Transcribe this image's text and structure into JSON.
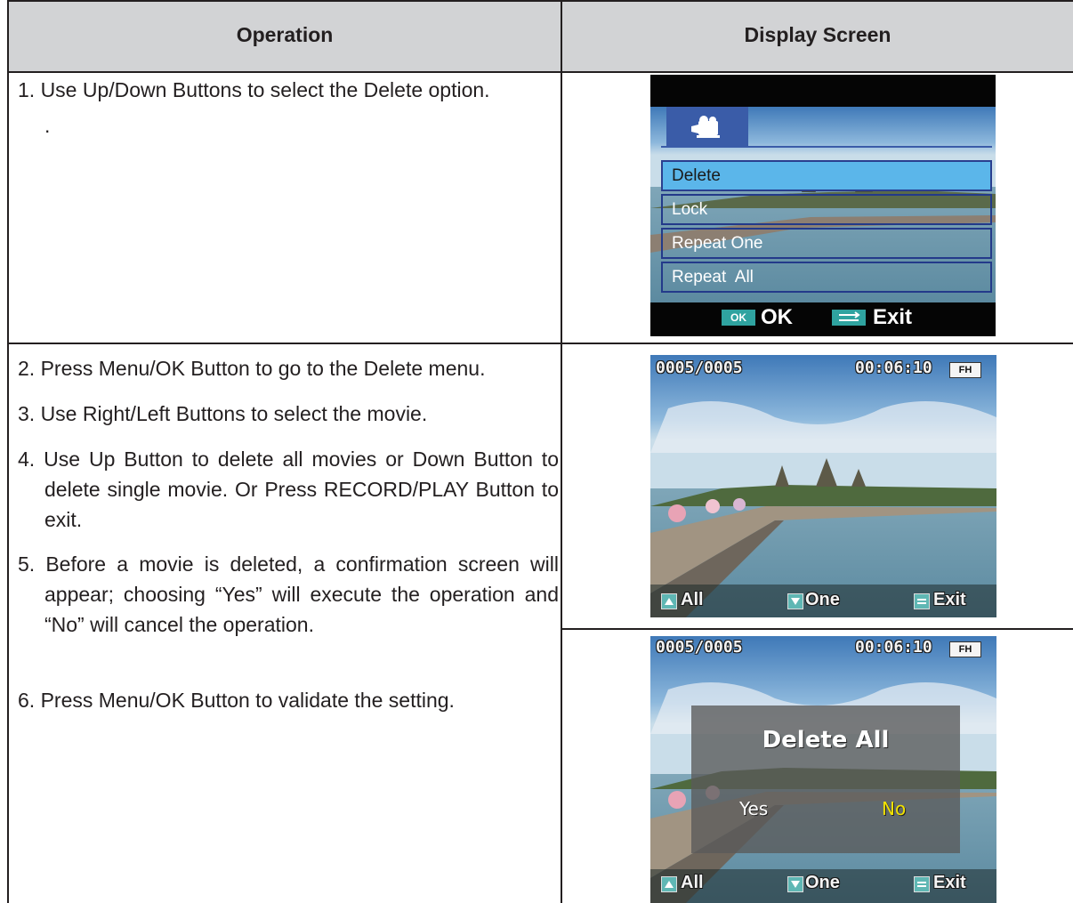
{
  "header": {
    "operation": "Operation",
    "display_screen": "Display Screen"
  },
  "rows": [
    {
      "steps": [
        "1. Use Up/Down Buttons to select the Delete option."
      ],
      "continuation": "."
    },
    {
      "steps": [
        "2. Press Menu/OK Button to go to the Delete menu.",
        "3. Use Right/Left Buttons to select the movie.",
        "4. Use Up Button to delete all movies or Down Button to delete single movie. Or Press RECORD/PLAY Button to exit.",
        "5. Before a movie is deleted, a confirmation screen will appear; choosing “Yes” will execute the operation and “No” will cancel the operation.",
        "6. Press Menu/OK Button to validate the setting."
      ]
    }
  ],
  "screen1": {
    "tab_icon": "movie-camera-icon",
    "menu_items": [
      "Delete",
      "Lock",
      "Repeat One",
      "Repeat  All"
    ],
    "selected_index": 0,
    "footer": {
      "ok_badge": "OK",
      "ok_label": "OK",
      "exit_icon": "return-icon",
      "exit_label": "Exit"
    }
  },
  "screen2": {
    "counter": "0005/0005",
    "time": "00:06:10",
    "quality_badge": "FH",
    "footer": {
      "all": "All",
      "one": "One",
      "exit": "Exit"
    }
  },
  "screen3": {
    "counter": "0005/0005",
    "time": "00:06:10",
    "quality_badge": "FH",
    "dialog_title": "Delete All",
    "yes": "Yes",
    "no": "No",
    "footer": {
      "all": "All",
      "one": "One",
      "exit": "Exit"
    }
  },
  "colors": {
    "header_bg": "#d2d3d5",
    "menu_highlight": "#5bb6ea",
    "no_highlight": "#f2e200",
    "ok_badge": "#2fa3a0"
  }
}
